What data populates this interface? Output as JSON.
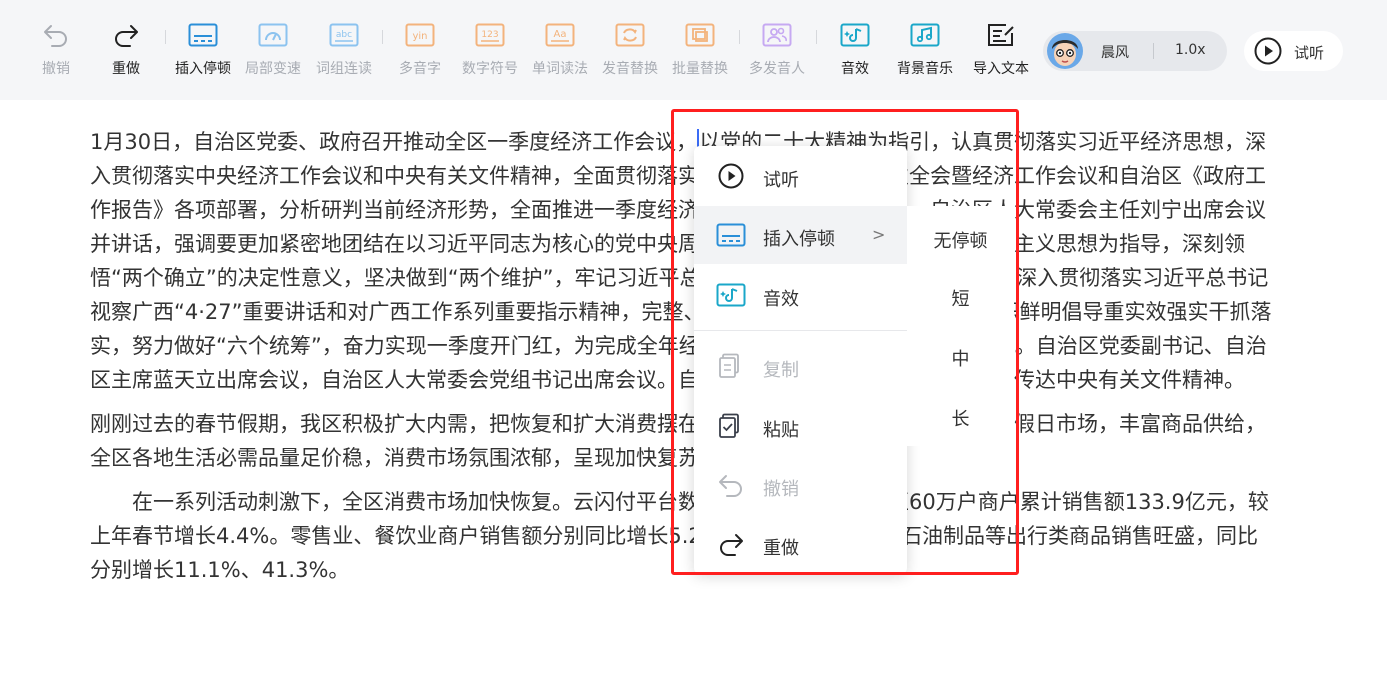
{
  "toolbar": {
    "items": [
      {
        "label": "撤销",
        "icon": "undo-icon"
      },
      {
        "label": "重做",
        "icon": "redo-icon"
      },
      {
        "label": "插入停顿",
        "icon": "insert-pause-icon"
      },
      {
        "label": "局部变速",
        "icon": "local-speed-icon"
      },
      {
        "label": "词组连读",
        "icon": "phrase-link-icon",
        "icon_text": "abc"
      },
      {
        "label": "多音字",
        "icon": "polyphone-icon",
        "icon_text": "yin"
      },
      {
        "label": "数字符号",
        "icon": "number-symbol-icon",
        "icon_text": "123"
      },
      {
        "label": "单词读法",
        "icon": "word-reading-icon",
        "icon_text": "Aa"
      },
      {
        "label": "发音替换",
        "icon": "pronunciation-replace-icon"
      },
      {
        "label": "批量替换",
        "icon": "batch-replace-icon"
      },
      {
        "label": "多发音人",
        "icon": "multi-speaker-icon"
      },
      {
        "label": "音效",
        "icon": "sound-effect-icon"
      },
      {
        "label": "背景音乐",
        "icon": "background-music-icon"
      },
      {
        "label": "导入文本",
        "icon": "import-text-icon"
      }
    ],
    "voice": {
      "name": "晨风",
      "speed": "1.0x",
      "avatar": "avatar"
    },
    "listen_label": "试听"
  },
  "colors": {
    "accent": "#1aa7c9",
    "orange_disabled": "#f3b37c",
    "blue_disabled": "#8cc3ef",
    "purple_disabled": "#c6a9f2",
    "highlight_box": "#ff1f1f",
    "caret": "#3b6cf6"
  },
  "document": {
    "p1_before_caret": "1月30日，自治区党委、政府召开推动全区一季度经济工作会议，",
    "p1_after_caret": "以党的二十大精神为指引，认真贯彻落实习近平经济思想，深入贯彻落实中央经济工作会议和中央有关文件精神，全面贯彻落实自治区党委十二届五次全会暨经济工作会议和自治区《政府工作报告》各项部署，分析研判当前经济形势，全面推进一季度经济工作。自治区党委书记、自治区人大常委会主任刘宁出席会议并讲话，强调要更加紧密地团结在以习近平同志为核心的党中央周围，以习近平新时代中国特色社会主义思想为指导，深刻领悟“两个确立”的决定性意义，坚决做到“两个维护”，牢记习近平总书记对广西“五个更大”重要要求，深入贯彻落实习近平总书记视察广西“4·27”重要讲话和对广西工作系列重要指示精神，完整、准确、全面贯彻新发展理念，旗帜鲜明倡导重实效强实干抓落实，努力做好“六个统筹”，奋力实现一季度开门红，为完成全年经济社会发展目标任务打下坚实基础。自治区党委副书记、自治区主席蓝天立出席会议，自治区人大常委会党组书记出席会议。自治区党委副书记刘小明主持会议并传达中央有关文件精神。",
    "p2": "刚刚过去的春节假期，我区积极扩大内需，把恢复和扩大消费摆在优先位置，全力激活节日消费活跃假日市场，丰富商品供给，全区各地生活必需品量足价稳，消费市场氛围浓郁，呈现加快复苏态势。",
    "p3": "在一系列活动刺激下，全区消费市场加快恢复。云闪付平台数据显示，春节期间全区60万户商户累计销售额133.9亿元，较上年春节增长4.4%。零售业、餐饮业商户销售额分别同比增长5.2%、3.1%。家具类及石油制品等出行类商品销售旺盛，同比分别增长11.1%、41.3%。"
  },
  "context_menu": {
    "items": [
      {
        "label": "试听",
        "icon": "play-icon"
      },
      {
        "label": "插入停顿",
        "icon": "insert-pause-icon",
        "arrow": ">"
      },
      {
        "label": "音效",
        "icon": "sound-effect-icon"
      },
      {
        "label": "复制",
        "icon": "copy-icon"
      },
      {
        "label": "粘贴",
        "icon": "paste-icon"
      },
      {
        "label": "撤销",
        "icon": "undo-icon"
      },
      {
        "label": "重做",
        "icon": "redo-icon"
      }
    ],
    "submenu": [
      "无停顿",
      "短",
      "中",
      "长"
    ]
  }
}
